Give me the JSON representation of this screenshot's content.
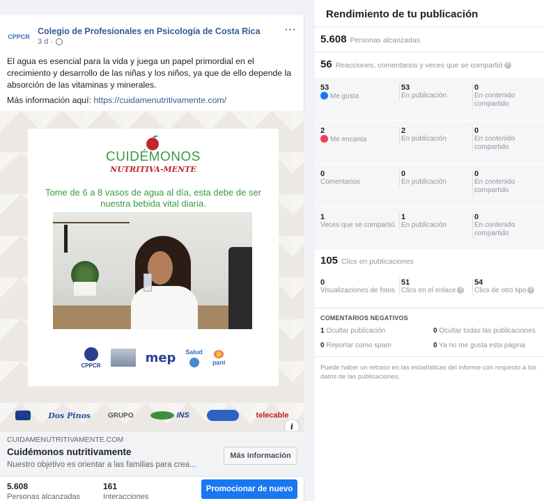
{
  "post": {
    "page_name": "Colegio de Profesionales en Psicología de Costa Rica",
    "time": "3 d ·",
    "avatar_text": "CPPCR",
    "more_label": "···",
    "text": "El agua es esencial para la vida y juega un papel primordial en el crecimiento y desarrollo de las niñas y los niños, ya que de ello depende la absorción de las vitaminas y minerales.",
    "more_info_label": "Más información aquí: ",
    "more_info_url": "https://cuidamenutritivamente.com/",
    "creative": {
      "brand_title": "CUIDÉMONOS",
      "brand_sub": "NUTRITIVA-MENTE",
      "headline": "Tome de 6 a 8 vasos de agua al día, esta debe de ser nuestra bebida vital diaria.",
      "logos_row1": [
        "CPPCR",
        "NUTRICIÓN",
        "mep",
        "Salud",
        "pani"
      ],
      "logos_row2": [
        "Dos Pinos",
        "GRUPO",
        "INS",
        "telecable"
      ],
      "info_glyph": "i"
    },
    "link": {
      "domain": "CUIDAMENUTRITIVAMENTE.COM",
      "title": "Cuidémonos nutritivamente",
      "description": "Nuestro objetivo es orientar a las familias para crea...",
      "button": "Más información"
    },
    "footer": {
      "reach_value": "5.608",
      "reach_label": "Personas alcanzadas",
      "interactions_value": "161",
      "interactions_label": "Interacciones",
      "promote_button": "Promocionar de nuevo"
    }
  },
  "panel": {
    "title": "Rendimiento de tu publicación",
    "reach": {
      "value": "5.608",
      "label": "Personas alcanzadas"
    },
    "reactions_total": {
      "value": "56",
      "label": "Reacciones, comentarios y veces que se compartió"
    },
    "rows": [
      {
        "v1": "53",
        "l1": "Me gusta",
        "v2": "53",
        "l2": "En publicación",
        "v3": "0",
        "l3": "En contenido compartido"
      },
      {
        "v1": "2",
        "l1": "Me encanta",
        "v2": "2",
        "l2": "En publicación",
        "v3": "0",
        "l3": "En contenido compartido"
      },
      {
        "v1": "0",
        "l1": "Comentarios",
        "v2": "0",
        "l2": "En publicación",
        "v3": "0",
        "l3": "En contenido compartido"
      },
      {
        "v1": "1",
        "l1": "Veces que se compartió",
        "v2": "1",
        "l2": "En publicación",
        "v3": "0",
        "l3": "En contenido compartido"
      }
    ],
    "clicks_total": {
      "value": "105",
      "label": "Clics en publicaciones"
    },
    "clicks": [
      {
        "value": "0",
        "label": "Visualizaciones de fotos"
      },
      {
        "value": "51",
        "label": "Clics en el enlace"
      },
      {
        "value": "54",
        "label": "Clics de otro tipo"
      }
    ],
    "negative": {
      "title": "COMENTARIOS NEGATIVOS",
      "hide_post": {
        "value": "1",
        "label": "Ocultar publicación"
      },
      "hide_all": {
        "value": "0",
        "label": "Ocultar todas las publicaciones"
      },
      "report_spam": {
        "value": "0",
        "label": "Reportar como spam"
      },
      "unlike_page": {
        "value": "0",
        "label": "Ya no me gusta esta página"
      }
    },
    "note": "Puede haber un retraso en las estadísticas del informe con respecto a los datos de las publicaciones."
  },
  "colors": {
    "accent": "#1877f2",
    "link": "#385898",
    "brand_green": "#3a9a3f",
    "brand_red": "#c2272d"
  }
}
